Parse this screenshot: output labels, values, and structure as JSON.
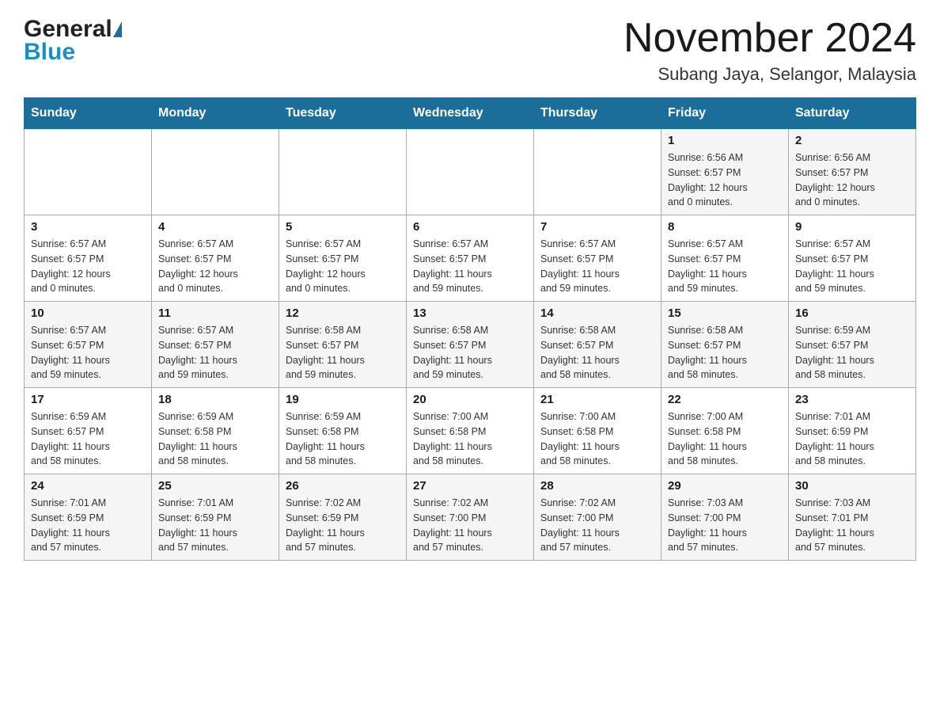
{
  "header": {
    "logo": {
      "general": "General",
      "blue": "Blue"
    },
    "month_title": "November 2024",
    "subtitle": "Subang Jaya, Selangor, Malaysia"
  },
  "calendar": {
    "days_of_week": [
      "Sunday",
      "Monday",
      "Tuesday",
      "Wednesday",
      "Thursday",
      "Friday",
      "Saturday"
    ],
    "weeks": [
      [
        {
          "day": "",
          "info": ""
        },
        {
          "day": "",
          "info": ""
        },
        {
          "day": "",
          "info": ""
        },
        {
          "day": "",
          "info": ""
        },
        {
          "day": "",
          "info": ""
        },
        {
          "day": "1",
          "info": "Sunrise: 6:56 AM\nSunset: 6:57 PM\nDaylight: 12 hours\nand 0 minutes."
        },
        {
          "day": "2",
          "info": "Sunrise: 6:56 AM\nSunset: 6:57 PM\nDaylight: 12 hours\nand 0 minutes."
        }
      ],
      [
        {
          "day": "3",
          "info": "Sunrise: 6:57 AM\nSunset: 6:57 PM\nDaylight: 12 hours\nand 0 minutes."
        },
        {
          "day": "4",
          "info": "Sunrise: 6:57 AM\nSunset: 6:57 PM\nDaylight: 12 hours\nand 0 minutes."
        },
        {
          "day": "5",
          "info": "Sunrise: 6:57 AM\nSunset: 6:57 PM\nDaylight: 12 hours\nand 0 minutes."
        },
        {
          "day": "6",
          "info": "Sunrise: 6:57 AM\nSunset: 6:57 PM\nDaylight: 11 hours\nand 59 minutes."
        },
        {
          "day": "7",
          "info": "Sunrise: 6:57 AM\nSunset: 6:57 PM\nDaylight: 11 hours\nand 59 minutes."
        },
        {
          "day": "8",
          "info": "Sunrise: 6:57 AM\nSunset: 6:57 PM\nDaylight: 11 hours\nand 59 minutes."
        },
        {
          "day": "9",
          "info": "Sunrise: 6:57 AM\nSunset: 6:57 PM\nDaylight: 11 hours\nand 59 minutes."
        }
      ],
      [
        {
          "day": "10",
          "info": "Sunrise: 6:57 AM\nSunset: 6:57 PM\nDaylight: 11 hours\nand 59 minutes."
        },
        {
          "day": "11",
          "info": "Sunrise: 6:57 AM\nSunset: 6:57 PM\nDaylight: 11 hours\nand 59 minutes."
        },
        {
          "day": "12",
          "info": "Sunrise: 6:58 AM\nSunset: 6:57 PM\nDaylight: 11 hours\nand 59 minutes."
        },
        {
          "day": "13",
          "info": "Sunrise: 6:58 AM\nSunset: 6:57 PM\nDaylight: 11 hours\nand 59 minutes."
        },
        {
          "day": "14",
          "info": "Sunrise: 6:58 AM\nSunset: 6:57 PM\nDaylight: 11 hours\nand 58 minutes."
        },
        {
          "day": "15",
          "info": "Sunrise: 6:58 AM\nSunset: 6:57 PM\nDaylight: 11 hours\nand 58 minutes."
        },
        {
          "day": "16",
          "info": "Sunrise: 6:59 AM\nSunset: 6:57 PM\nDaylight: 11 hours\nand 58 minutes."
        }
      ],
      [
        {
          "day": "17",
          "info": "Sunrise: 6:59 AM\nSunset: 6:57 PM\nDaylight: 11 hours\nand 58 minutes."
        },
        {
          "day": "18",
          "info": "Sunrise: 6:59 AM\nSunset: 6:58 PM\nDaylight: 11 hours\nand 58 minutes."
        },
        {
          "day": "19",
          "info": "Sunrise: 6:59 AM\nSunset: 6:58 PM\nDaylight: 11 hours\nand 58 minutes."
        },
        {
          "day": "20",
          "info": "Sunrise: 7:00 AM\nSunset: 6:58 PM\nDaylight: 11 hours\nand 58 minutes."
        },
        {
          "day": "21",
          "info": "Sunrise: 7:00 AM\nSunset: 6:58 PM\nDaylight: 11 hours\nand 58 minutes."
        },
        {
          "day": "22",
          "info": "Sunrise: 7:00 AM\nSunset: 6:58 PM\nDaylight: 11 hours\nand 58 minutes."
        },
        {
          "day": "23",
          "info": "Sunrise: 7:01 AM\nSunset: 6:59 PM\nDaylight: 11 hours\nand 58 minutes."
        }
      ],
      [
        {
          "day": "24",
          "info": "Sunrise: 7:01 AM\nSunset: 6:59 PM\nDaylight: 11 hours\nand 57 minutes."
        },
        {
          "day": "25",
          "info": "Sunrise: 7:01 AM\nSunset: 6:59 PM\nDaylight: 11 hours\nand 57 minutes."
        },
        {
          "day": "26",
          "info": "Sunrise: 7:02 AM\nSunset: 6:59 PM\nDaylight: 11 hours\nand 57 minutes."
        },
        {
          "day": "27",
          "info": "Sunrise: 7:02 AM\nSunset: 7:00 PM\nDaylight: 11 hours\nand 57 minutes."
        },
        {
          "day": "28",
          "info": "Sunrise: 7:02 AM\nSunset: 7:00 PM\nDaylight: 11 hours\nand 57 minutes."
        },
        {
          "day": "29",
          "info": "Sunrise: 7:03 AM\nSunset: 7:00 PM\nDaylight: 11 hours\nand 57 minutes."
        },
        {
          "day": "30",
          "info": "Sunrise: 7:03 AM\nSunset: 7:01 PM\nDaylight: 11 hours\nand 57 minutes."
        }
      ]
    ]
  }
}
